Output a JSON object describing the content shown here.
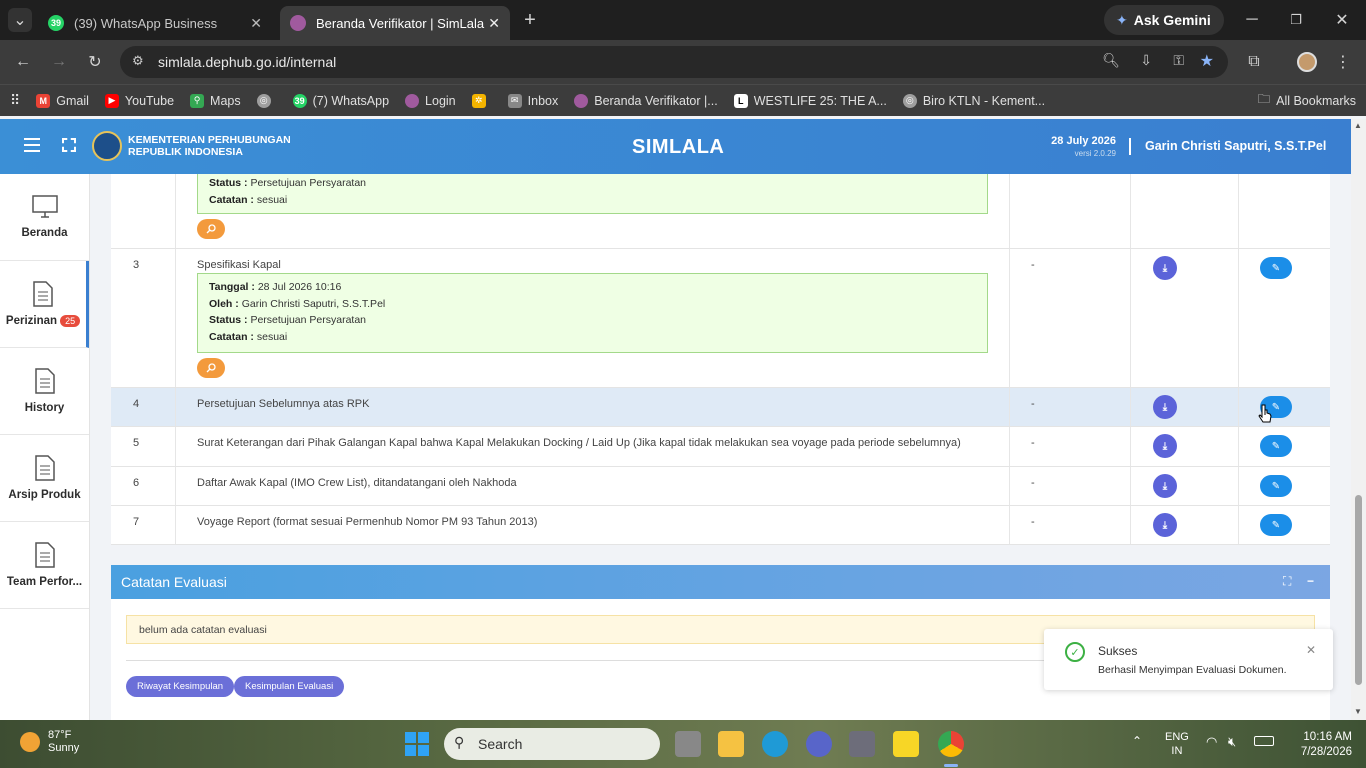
{
  "browser": {
    "tabs": [
      {
        "title": "(39) WhatsApp Business",
        "favicon_badge": "39",
        "active": false
      },
      {
        "title": "Beranda Verifikator | SimLala",
        "active": true
      }
    ],
    "new_tab_icon": "plus-icon",
    "gemini_label": "Ask Gemini",
    "url": "simlala.dephub.go.id/internal",
    "bookmarks": [
      {
        "label": "Gmail",
        "icon": "gmail-icon",
        "color": "#ea4335"
      },
      {
        "label": "YouTube",
        "icon": "youtube-icon",
        "color": "#ff0000"
      },
      {
        "label": "Maps",
        "icon": "maps-icon",
        "color": "#34a853"
      },
      {
        "label": "",
        "icon": "globe-icon",
        "color": "#9e9e9e"
      },
      {
        "label": "(7) WhatsApp",
        "icon": "whatsapp-icon",
        "color": "#25d366",
        "badge": "39"
      },
      {
        "label": "Login",
        "icon": "login-icon",
        "color": "#a05a9e"
      },
      {
        "label": "",
        "icon": "pinwheel-icon",
        "color": "#f4b400"
      },
      {
        "label": "Inbox",
        "icon": "mail-icon",
        "color": "#888888"
      },
      {
        "label": "Beranda Verifikator |...",
        "icon": "simlala-icon",
        "color": "#a05a9e"
      },
      {
        "label": "WESTLIFE 25: THE A...",
        "icon": "bookmark-l-icon",
        "color": "#ffffff"
      },
      {
        "label": "Biro KTLN - Kement...",
        "icon": "globe-icon",
        "color": "#9e9e9e"
      }
    ],
    "all_bookmarks": "All Bookmarks"
  },
  "app": {
    "brand_line1": "KEMENTERIAN PERHUBUNGAN",
    "brand_line2": "REPUBLIK INDONESIA",
    "title": "SIMLALA",
    "date": "28 July 2026",
    "version": "versi 2.0.29",
    "user": "Garin Christi Saputri, S.S.T.Pel"
  },
  "sidebar": {
    "items": [
      {
        "label": "Beranda",
        "icon": "monitor-icon"
      },
      {
        "label": "Perizinan",
        "icon": "document-icon",
        "badge": "25",
        "active": true
      },
      {
        "label": "History",
        "icon": "document-icon"
      },
      {
        "label": "Arsip Produk",
        "icon": "document-icon"
      },
      {
        "label": "Team Perfor...",
        "icon": "document-icon"
      }
    ]
  },
  "table": {
    "partial_row": {
      "status_label": "Status :",
      "status": "Persetujuan Persyaratan",
      "catatan_label": "Catatan :",
      "catatan": "sesuai"
    },
    "rows": [
      {
        "no": "3",
        "name": "Spesifikasi Kapal",
        "value": "-",
        "note": {
          "tanggal_label": "Tanggal :",
          "tanggal": "28 Jul 2026 10:16",
          "oleh_label": "Oleh :",
          "oleh": "Garin Christi Saputri, S.S.T.Pel",
          "status_label": "Status :",
          "status": "Persetujuan Persyaratan",
          "catatan_label": "Catatan :",
          "catatan": "sesuai"
        }
      },
      {
        "no": "4",
        "name": "Persetujuan Sebelumnya atas RPK",
        "value": "-",
        "highlight": true
      },
      {
        "no": "5",
        "name": "Surat Keterangan dari Pihak Galangan Kapal bahwa Kapal Melakukan Docking / Laid Up (Jika kapal tidak melakukan sea voyage pada periode sebelumnya)",
        "value": "-"
      },
      {
        "no": "6",
        "name": "Daftar Awak Kapal (IMO Crew List), ditandatangani oleh Nakhoda",
        "value": "-"
      },
      {
        "no": "7",
        "name": "Voyage Report (format sesuai Permenhub Nomor PM 93 Tahun 2013)",
        "value": "-"
      }
    ]
  },
  "evaluation": {
    "title": "Catatan Evaluasi",
    "message": "belum ada catatan evaluasi",
    "btn_history": "Riwayat Kesimpulan",
    "btn_conclusion": "Kesimpulan Evaluasi"
  },
  "toast": {
    "title": "Sukses",
    "message": "Berhasil Menyimpan Evaluasi Dokumen."
  },
  "taskbar": {
    "temperature": "87°F",
    "weather": "Sunny",
    "search_placeholder": "Search",
    "lang1": "ENG",
    "lang2": "IN",
    "time": "10:16 AM",
    "date": "7/28/2026"
  }
}
